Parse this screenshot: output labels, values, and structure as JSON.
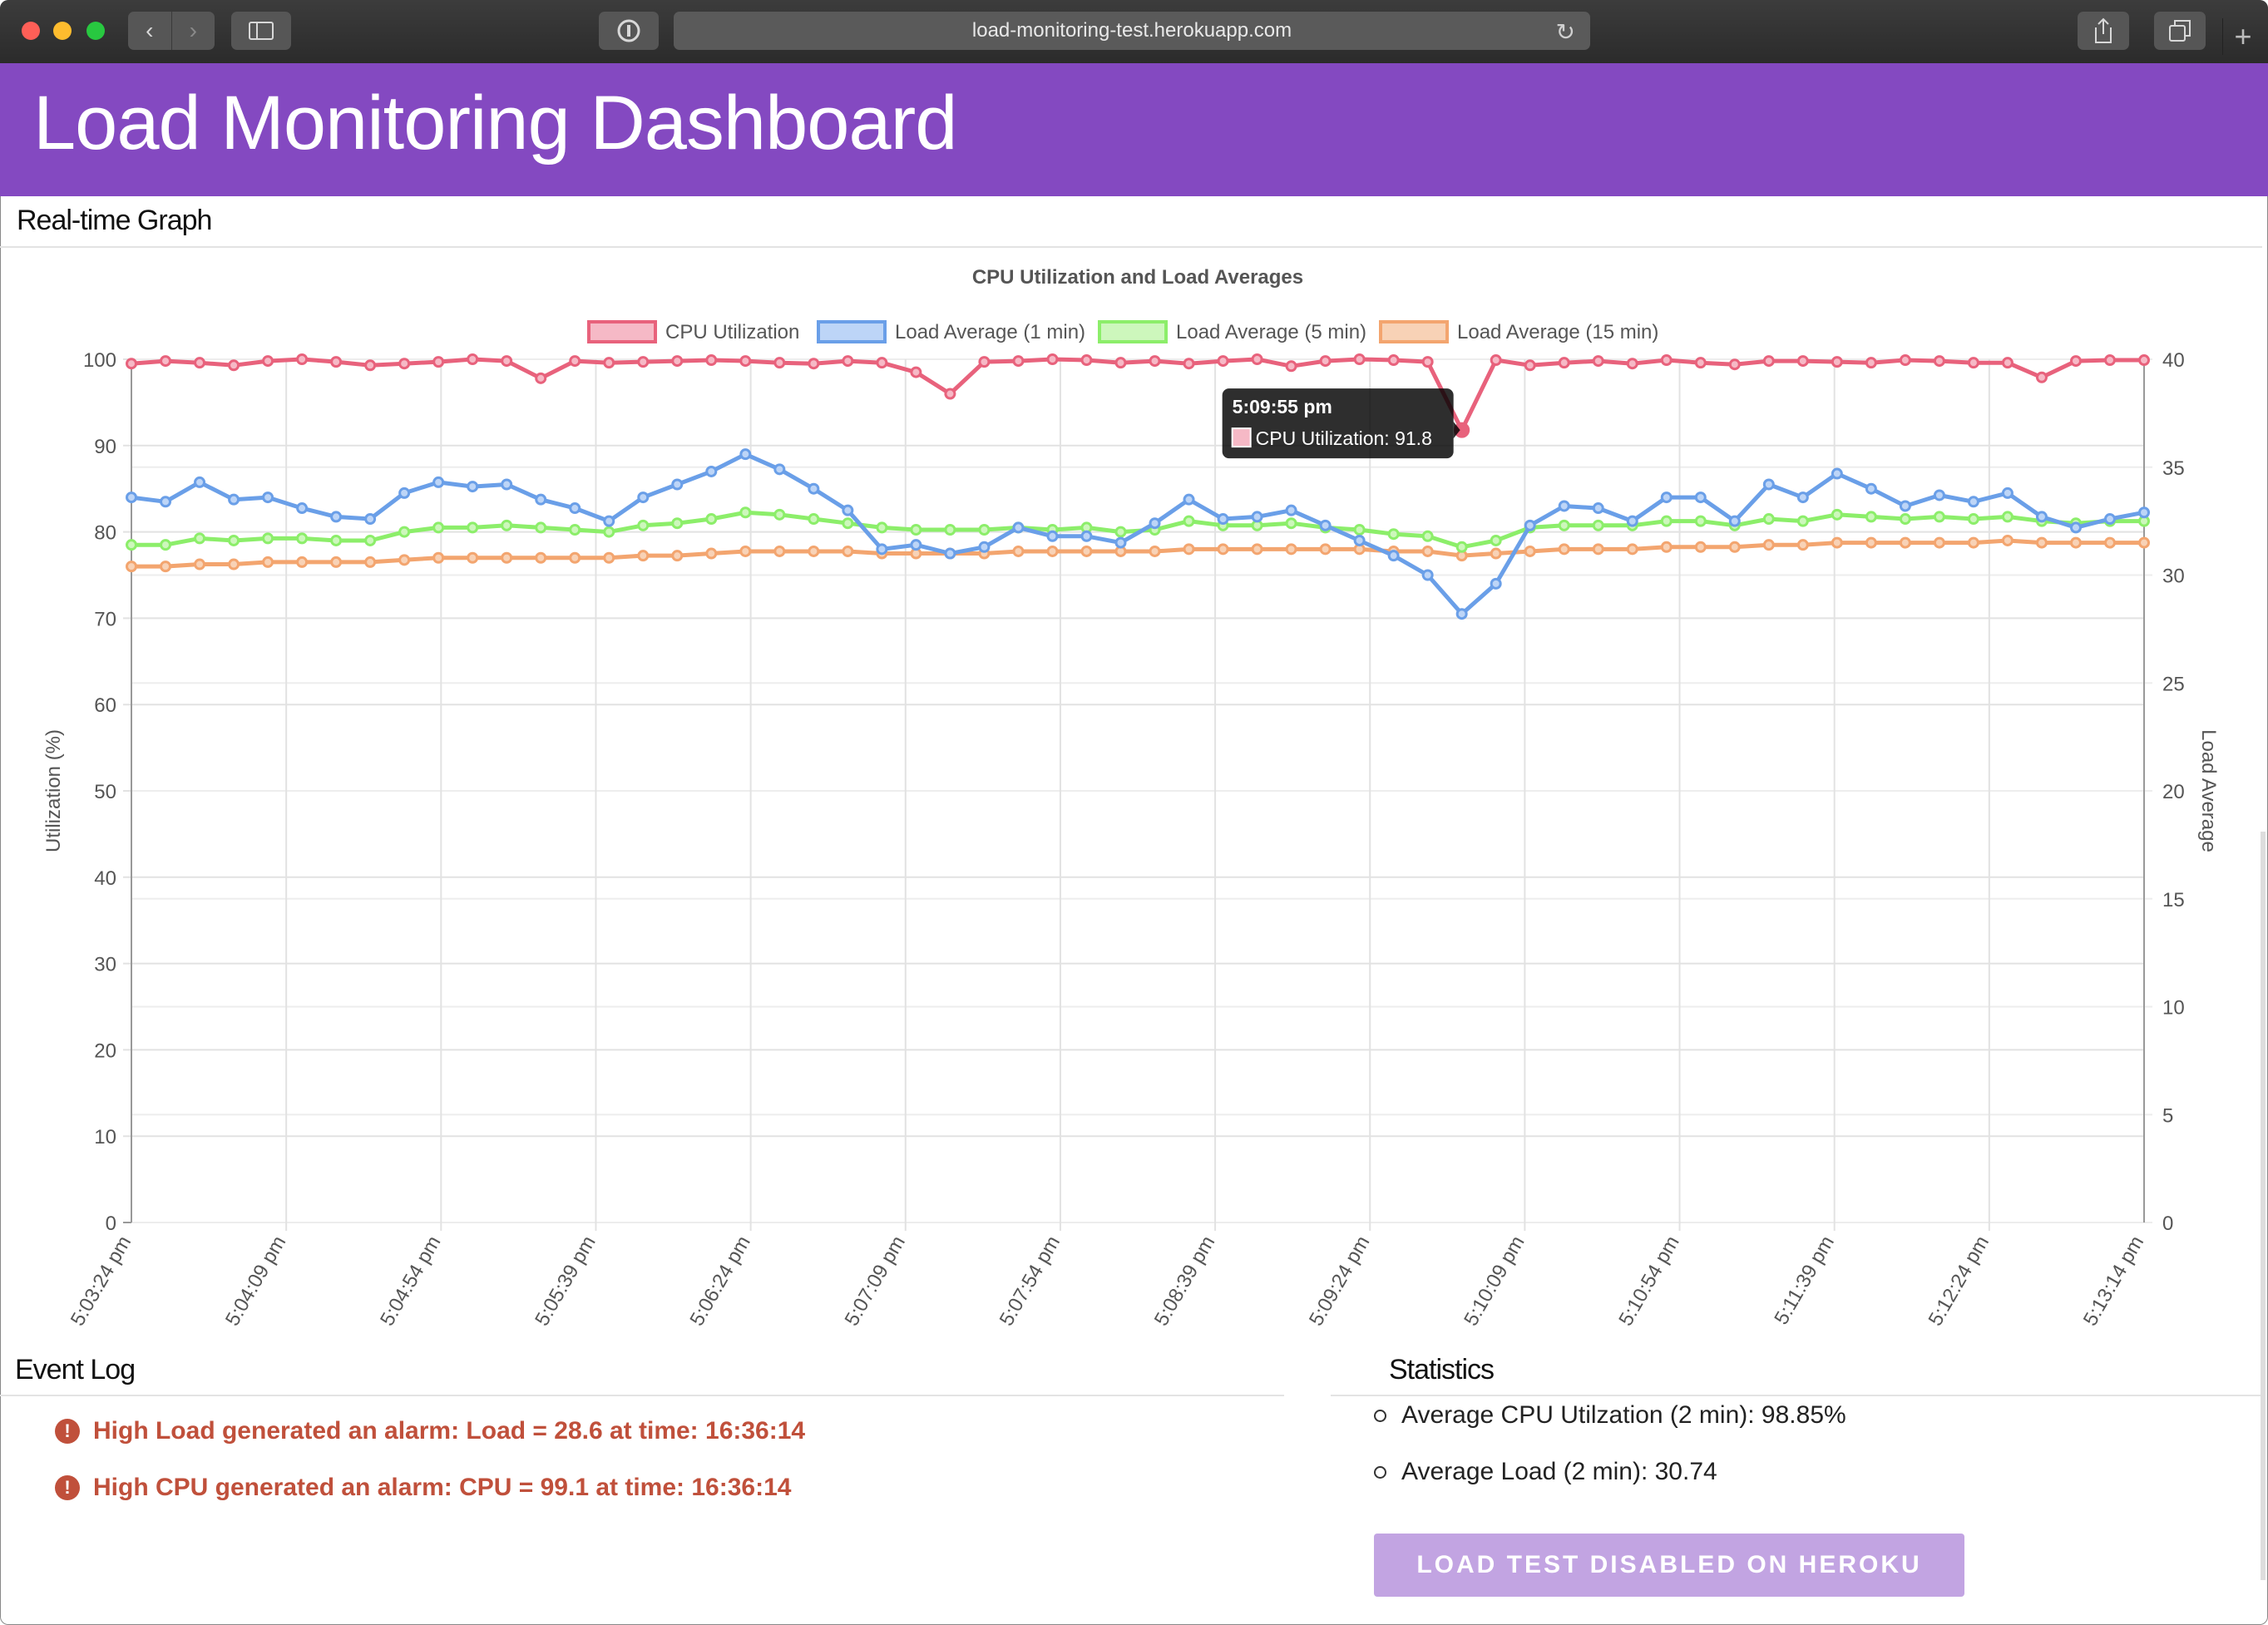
{
  "browser": {
    "url": "load-monitoring-test.herokuapp.com",
    "icons": {
      "back": "chevron-left-icon",
      "forward": "chevron-right-icon",
      "sidebar": "sidebar-icon",
      "privacy": "shield-icon",
      "reload": "reload-icon",
      "share": "share-icon",
      "tabs": "tabs-icon",
      "new_tab": "plus-icon"
    }
  },
  "header": {
    "title": "Load Monitoring Dashboard",
    "color": "#8449c1"
  },
  "realtime": {
    "title": "Real-time Graph"
  },
  "chart_data": {
    "type": "line",
    "title": "CPU Utilization and Load Averages",
    "legend_position": "top",
    "ylabel": "Utilization (%)",
    "ylabel_right": "Load Average",
    "ylim": [
      0,
      100
    ],
    "ylim_right": [
      0,
      40
    ],
    "yticks": [
      0,
      10,
      20,
      30,
      40,
      50,
      60,
      70,
      80,
      90,
      100
    ],
    "yticks_right": [
      0,
      5,
      10,
      15,
      20,
      25,
      30,
      35,
      40
    ],
    "xtick_labels": [
      "5:03:24 pm",
      "5:04:09 pm",
      "5:04:54 pm",
      "5:05:39 pm",
      "5:06:24 pm",
      "5:07:09 pm",
      "5:07:54 pm",
      "5:08:39 pm",
      "5:09:24 pm",
      "5:10:09 pm",
      "5:10:54 pm",
      "5:11:39 pm",
      "5:12:24 pm",
      "5:13:14 pm"
    ],
    "grid": true,
    "series": [
      {
        "name": "CPU Utilization",
        "axis": "left",
        "color": "#e8627c",
        "fill": "#f6b9c6",
        "values": [
          99.5,
          99.8,
          99.6,
          99.3,
          99.8,
          100,
          99.7,
          99.3,
          99.5,
          99.7,
          100,
          99.8,
          97.8,
          99.8,
          99.6,
          99.7,
          99.8,
          99.9,
          99.8,
          99.6,
          99.5,
          99.8,
          99.6,
          98.5,
          96,
          99.7,
          99.8,
          100,
          99.9,
          99.6,
          99.8,
          99.5,
          99.8,
          100,
          99.2,
          99.8,
          100,
          99.9,
          99.7,
          91.8,
          99.9,
          99.3,
          99.6,
          99.8,
          99.5,
          99.9,
          99.6,
          99.4,
          99.8,
          99.8,
          99.7,
          99.6,
          99.9,
          99.8,
          99.6,
          99.6,
          97.9,
          99.8,
          99.9,
          99.9
        ]
      },
      {
        "name": "Load Average (1 min)",
        "axis": "right",
        "color": "#6a9fe8",
        "fill": "#bdd5f7",
        "values": [
          33.6,
          33.4,
          34.3,
          33.5,
          33.6,
          33.1,
          32.7,
          32.6,
          33.8,
          34.3,
          34.1,
          34.2,
          33.5,
          33.1,
          32.5,
          33.6,
          34.2,
          34.8,
          35.6,
          34.9,
          34.0,
          33.0,
          31.2,
          31.4,
          31.0,
          31.3,
          32.2,
          31.8,
          31.8,
          31.5,
          32.4,
          33.5,
          32.6,
          32.7,
          33.0,
          32.3,
          31.6,
          30.9,
          30.0,
          28.2,
          29.6,
          32.3,
          33.2,
          33.1,
          32.5,
          33.6,
          33.6,
          32.5,
          34.2,
          33.6,
          34.7,
          34.0,
          33.2,
          33.7,
          33.4,
          33.8,
          32.7,
          32.2,
          32.6,
          32.9
        ]
      },
      {
        "name": "Load Average (5 min)",
        "axis": "right",
        "color": "#8cee6a",
        "fill": "#cdf7bc",
        "values": [
          31.4,
          31.4,
          31.7,
          31.6,
          31.7,
          31.7,
          31.6,
          31.6,
          32.0,
          32.2,
          32.2,
          32.3,
          32.2,
          32.1,
          32.0,
          32.3,
          32.4,
          32.6,
          32.9,
          32.8,
          32.6,
          32.4,
          32.2,
          32.1,
          32.1,
          32.1,
          32.2,
          32.1,
          32.2,
          32.0,
          32.1,
          32.5,
          32.3,
          32.3,
          32.4,
          32.2,
          32.1,
          31.9,
          31.8,
          31.3,
          31.6,
          32.2,
          32.3,
          32.3,
          32.3,
          32.5,
          32.5,
          32.3,
          32.6,
          32.5,
          32.8,
          32.7,
          32.6,
          32.7,
          32.6,
          32.7,
          32.5,
          32.4,
          32.5,
          32.5
        ]
      },
      {
        "name": "Load Average (15 min)",
        "axis": "right",
        "color": "#f3a56f",
        "fill": "#f8d2b6",
        "values": [
          30.4,
          30.4,
          30.5,
          30.5,
          30.6,
          30.6,
          30.6,
          30.6,
          30.7,
          30.8,
          30.8,
          30.8,
          30.8,
          30.8,
          30.8,
          30.9,
          30.9,
          31.0,
          31.1,
          31.1,
          31.1,
          31.1,
          31.0,
          31.0,
          31.0,
          31.0,
          31.1,
          31.1,
          31.1,
          31.1,
          31.1,
          31.2,
          31.2,
          31.2,
          31.2,
          31.2,
          31.2,
          31.1,
          31.1,
          30.9,
          31.0,
          31.1,
          31.2,
          31.2,
          31.2,
          31.3,
          31.3,
          31.3,
          31.4,
          31.4,
          31.5,
          31.5,
          31.5,
          31.5,
          31.5,
          31.6,
          31.5,
          31.5,
          31.5,
          31.5
        ]
      }
    ],
    "tooltip": {
      "title": "5:09:55 pm",
      "label": "CPU Utilization: 91.8",
      "series_index": 0,
      "point_index": 39
    }
  },
  "event_log": {
    "title": "Event Log",
    "alarm_color": "#c0503b",
    "entries": [
      "High Load generated an alarm: Load = 28.6 at time: 16:36:14",
      "High CPU generated an alarm: CPU = 99.1 at time: 16:36:14"
    ]
  },
  "statistics": {
    "title": "Statistics",
    "items": [
      "Average CPU Utilzation (2 min): 98.85%",
      "Average Load (2 min): 30.74"
    ],
    "button_label": "LOAD TEST DISABLED ON HEROKU"
  }
}
